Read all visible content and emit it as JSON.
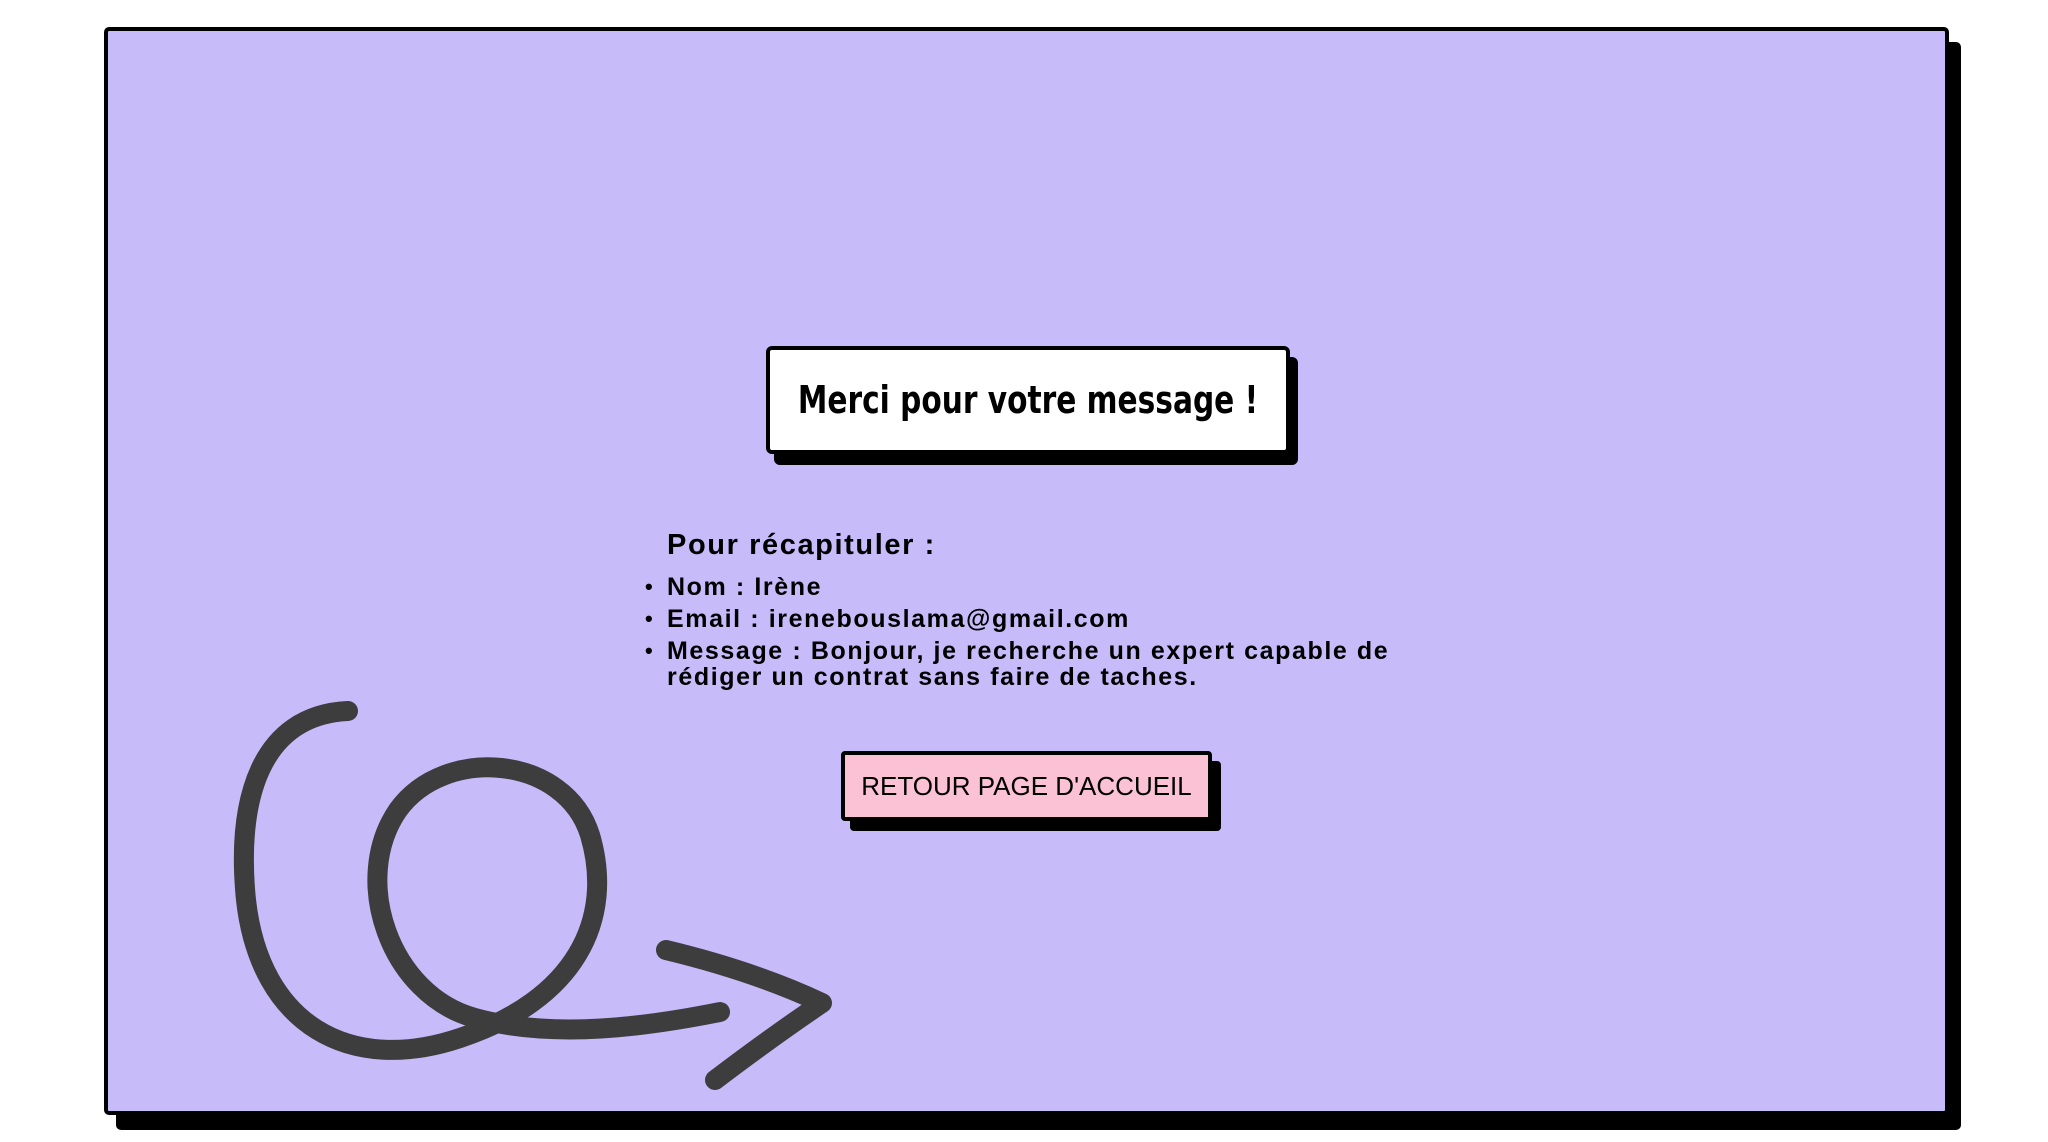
{
  "page": {
    "title": "Merci pour votre message !"
  },
  "recap": {
    "heading": "Pour récapituler :",
    "items": [
      {
        "label": "Nom",
        "value": "Irène",
        "text": "Nom : Irène"
      },
      {
        "label": "Email",
        "value": "irenebouslama@gmail.com",
        "text": "Email : irenebouslama@gmail.com"
      },
      {
        "label": "Message",
        "value": "Bonjour, je recherche un expert capable de rédiger un contrat sans faire de taches.",
        "text": "Message : Bonjour, je recherche un expert capable de rédiger un contrat sans faire de taches."
      }
    ],
    "bullet": "•"
  },
  "actions": {
    "home_button_label": "RETOUR PAGE D'ACCUEIL"
  },
  "decor": {
    "arrow_icon": "hand-drawn-loop-arrow-icon"
  },
  "colors": {
    "card_background": "#c7bbf9",
    "title_background": "#ffffff",
    "button_background": "#fbc1d4",
    "border": "#000000",
    "arrow_stroke": "#3d3d3d"
  }
}
